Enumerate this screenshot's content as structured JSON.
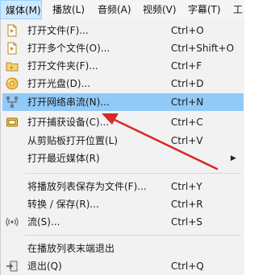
{
  "menubar": {
    "items": [
      {
        "label": "媒体(M)"
      },
      {
        "label": "播放(L)"
      },
      {
        "label": "音频(A)"
      },
      {
        "label": "视频(V)"
      },
      {
        "label": "字幕(T)"
      },
      {
        "label": "工"
      }
    ]
  },
  "menu": {
    "items": [
      {
        "label": "打开文件(F)...",
        "shortcut": "Ctrl+O",
        "icon": "open-file-icon"
      },
      {
        "label": "打开多个文件(O)...",
        "shortcut": "Ctrl+Shift+O",
        "icon": "open-multiple-files-icon"
      },
      {
        "label": "打开文件夹(F)...",
        "shortcut": "Ctrl+F",
        "icon": "folder-icon"
      },
      {
        "label": "打开光盘(D)...",
        "shortcut": "Ctrl+D",
        "icon": "disc-icon"
      },
      {
        "label": "打开网络串流(N)...",
        "shortcut": "Ctrl+N",
        "icon": "network-icon"
      },
      {
        "label": "打开捕获设备(C)...",
        "shortcut": "Ctrl+C",
        "icon": "capture-device-icon"
      },
      {
        "label": "从剪贴板打开位置(L)",
        "shortcut": "Ctrl+V",
        "icon": ""
      },
      {
        "label": "打开最近媒体(R)",
        "shortcut": "",
        "icon": ""
      },
      {
        "label": "将播放列表保存为文件(F)...",
        "shortcut": "Ctrl+Y",
        "icon": ""
      },
      {
        "label": "转换 / 保存(R)...",
        "shortcut": "Ctrl+R",
        "icon": ""
      },
      {
        "label": "流(S)...",
        "shortcut": "Ctrl+S",
        "icon": "stream-icon"
      },
      {
        "label": "在播放列表末端退出",
        "shortcut": "",
        "icon": ""
      },
      {
        "label": "退出(Q)",
        "shortcut": "Ctrl+Q",
        "icon": "exit-icon"
      }
    ],
    "submenu_arrow": "▶"
  },
  "colors": {
    "highlight": "#91c9f7",
    "annotation_arrow": "#d62a2a"
  }
}
